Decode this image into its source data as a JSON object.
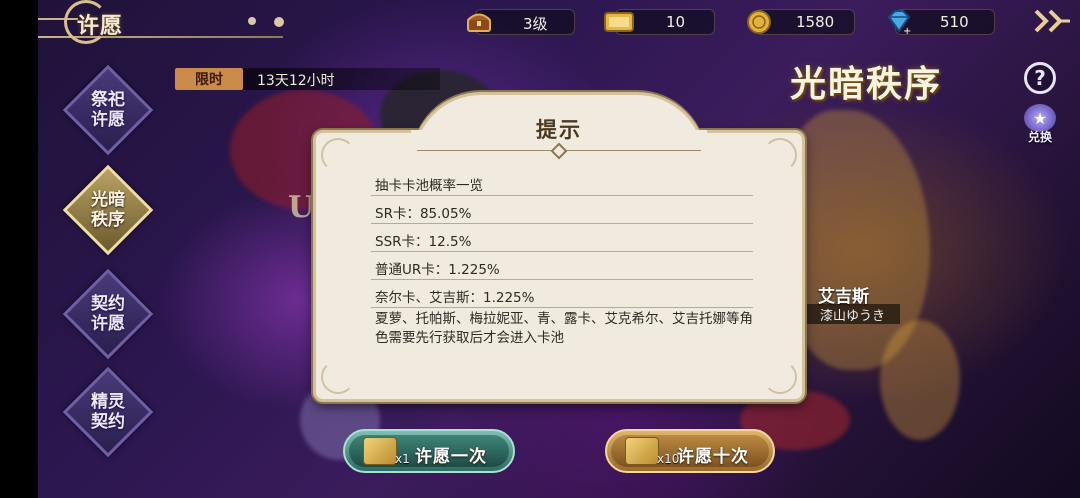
{
  "header": {
    "title": "许愿",
    "resources": {
      "level": "3级",
      "tickets": "10",
      "gold": "1580",
      "gems": "510"
    }
  },
  "timer": {
    "tag": "限时",
    "remaining": "13天12小时"
  },
  "side_menu": [
    {
      "label": "祭祀许愿",
      "active": false
    },
    {
      "label": "光暗秩序",
      "active": true
    },
    {
      "label": "契约许愿",
      "active": false
    },
    {
      "label": "精灵契约",
      "active": false
    }
  ],
  "banner": {
    "title": "光暗秩序",
    "character_name": "艾吉斯",
    "cv": "漆山ゆうき",
    "rarity": "UR"
  },
  "right_buttons": {
    "exchange_label": "兑换"
  },
  "bottom_buttons": {
    "wish_once": {
      "label": "许愿一次",
      "cost": "1"
    },
    "wish_ten": {
      "label": "许愿十次",
      "cost": "10"
    }
  },
  "dialog": {
    "title": "提示",
    "rows": [
      "抽卡卡池概率一览",
      "SR卡：85.05%",
      "SSR卡：12.5%",
      "普通UR卡：1.225%",
      "奈尔卡、艾吉斯：1.225%"
    ],
    "note": "夏萝、托帕斯、梅拉妮亚、青、露卡、艾克希尔、艾吉托娜等角色需要先行获取后才会进入卡池"
  },
  "colors": {
    "dialog_bg": "#f1ebdf",
    "dialog_border": "#d3c29a",
    "accent_gold": "#e8cf94",
    "timer_tag": "#c98a4a"
  }
}
